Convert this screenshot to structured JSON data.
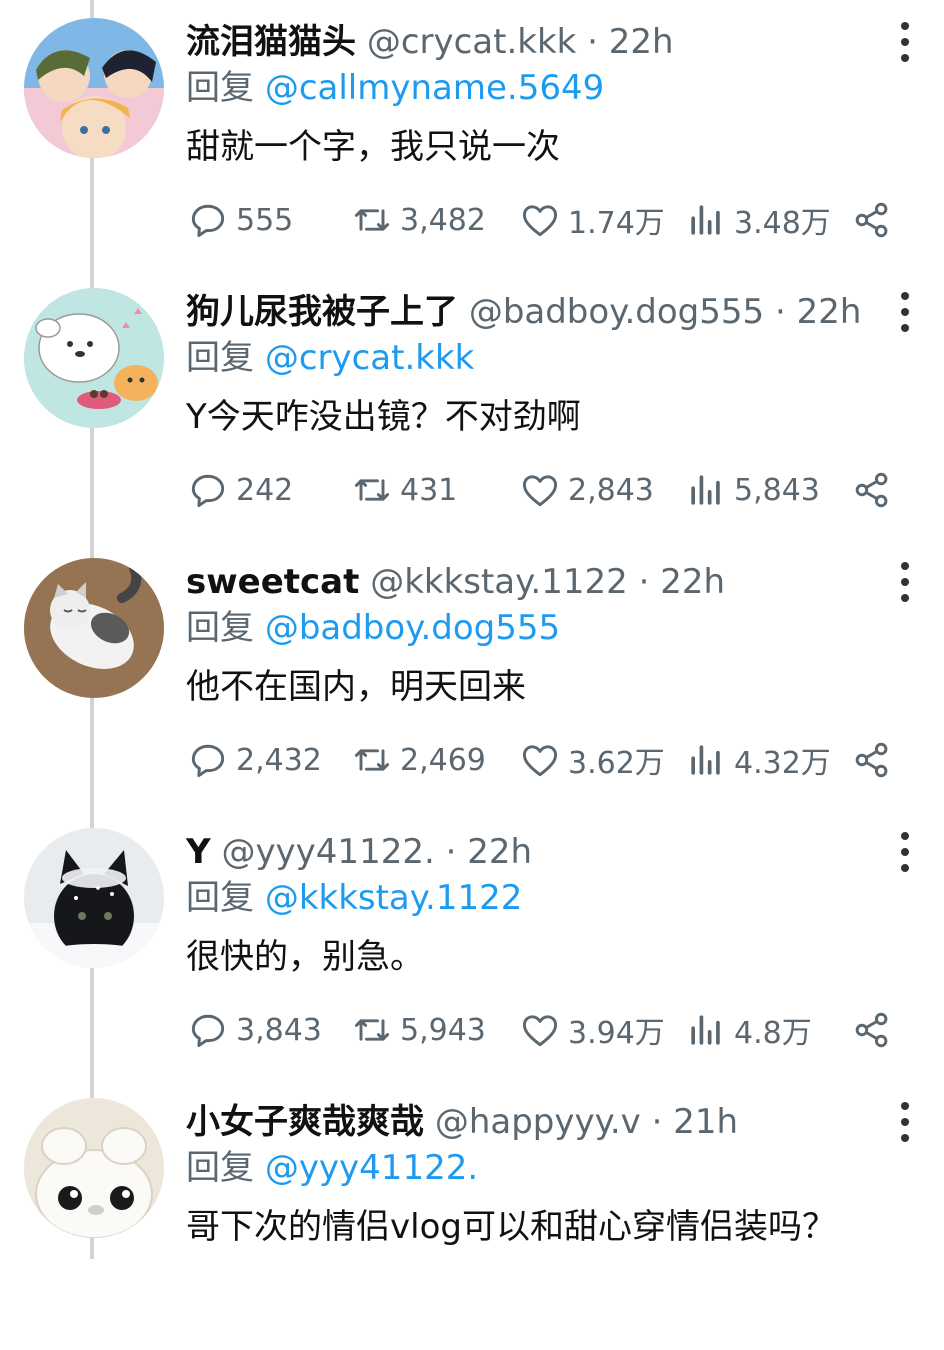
{
  "posts": [
    {
      "name": "流泪猫猫头",
      "handle": "@crycat.kkk",
      "time": "22h",
      "reply_prefix": "回复",
      "reply_to": "@callmyname.5649",
      "text": "甜就一个字，我只说一次",
      "replies": "555",
      "retweets": "3,482",
      "likes": "1.74万",
      "views": "3.48万"
    },
    {
      "name": "狗儿尿我被子上了",
      "handle": "@badboy.dog555",
      "time": "22h",
      "reply_prefix": "回复",
      "reply_to": "@crycat.kkk",
      "text": "Y今天咋没出镜？不对劲啊",
      "replies": "242",
      "retweets": "431",
      "likes": "2,843",
      "views": "5,843"
    },
    {
      "name": "sweetcat",
      "handle": "@kkkstay.1122",
      "time": "22h",
      "reply_prefix": "回复",
      "reply_to": "@badboy.dog555",
      "text": "他不在国内，明天回来",
      "replies": "2,432",
      "retweets": "2,469",
      "likes": "3.62万",
      "views": "4.32万"
    },
    {
      "name": "Y",
      "handle": "@yyy41122.",
      "time": "22h",
      "reply_prefix": "回复",
      "reply_to": "@kkkstay.1122",
      "text": "很快的，别急。",
      "replies": "3,843",
      "retweets": "5,943",
      "likes": "3.94万",
      "views": "4.8万"
    },
    {
      "name": "小女子爽哉爽哉",
      "handle": "@happyyy.v",
      "time": "21h",
      "reply_prefix": "回复",
      "reply_to": "@yyy41122.",
      "text": "哥下次的情侣vlog可以和甜心穿情侣装吗？"
    }
  ],
  "separator": "·",
  "colors": {
    "link": "#1d9bf0",
    "muted": "#5b6770",
    "text": "#111111",
    "thread_line": "#d3d3d3"
  },
  "icons": [
    "reply-icon",
    "retweet-icon",
    "like-icon",
    "views-icon",
    "share-icon",
    "more-icon"
  ]
}
